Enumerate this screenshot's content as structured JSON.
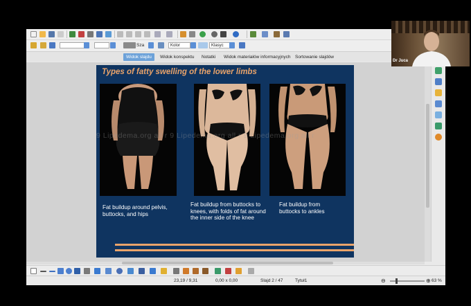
{
  "toolbar": {
    "line_style_value": "",
    "line_width_value": "",
    "area_style": "Sza",
    "color_mode": "Kolor",
    "area_fill": "Klasyc"
  },
  "view_tabs": [
    {
      "label": "Widok slajdu",
      "active": true
    },
    {
      "label": "Widok konspektu",
      "active": false
    },
    {
      "label": "Notatki",
      "active": false
    },
    {
      "label": "Widok materiałów informacyjnych",
      "active": false
    },
    {
      "label": "Sortowanie slajdów",
      "active": false
    }
  ],
  "slide": {
    "title": "Types of fatty swelling  of the lower limbs",
    "watermark": "9 Lipedema.org  all r   9 Lipedema.org  all r   9 Lipedema.org  all r",
    "captions": [
      "Fat buildup around pelvis, buttocks, and hips",
      "Fat buildup from buttocks to knees, with folds of fat around the inner side of the knee",
      "Fat buildup from buttocks to ankles"
    ],
    "accent_color": "#e9a36a",
    "background_color": "#0f3460"
  },
  "status": {
    "position": "23,19 / 9,31",
    "size": "0,00 x 0,00",
    "slide": "Slajd 2 / 47",
    "layout": "Tytuł1",
    "zoom": "63 %"
  },
  "video": {
    "participant_name": "Dr Juca"
  }
}
